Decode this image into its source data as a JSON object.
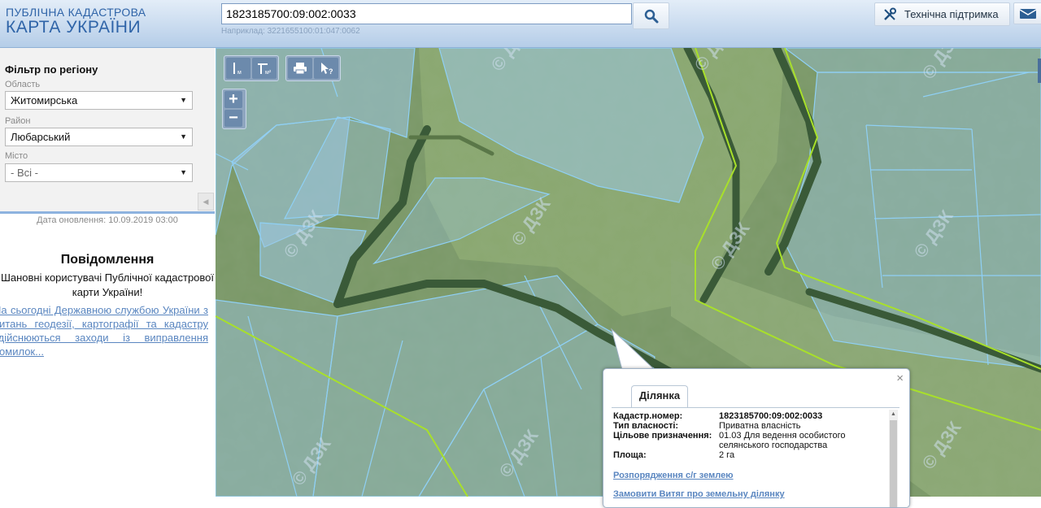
{
  "app": {
    "logo_line1": "ПУБЛІЧНА КАДАСТРОВА",
    "logo_line2": "КАРТА УКРАЇНИ"
  },
  "search": {
    "value": "1823185700:09:002:0033",
    "hint": "Наприклад: 3221655100:01:047:0062"
  },
  "header": {
    "support_label": "Технічна підтримка"
  },
  "filter": {
    "title": "Фільтр по регіону",
    "oblast_label": "Область",
    "oblast_value": "Житомирська",
    "rayon_label": "Район",
    "rayon_value": "Любарський",
    "city_label": "Місто",
    "city_value": "- Всі -"
  },
  "sidebar": {
    "update_date": "Дата оновлення: 10.09.2019 03:00",
    "notice_title": "Повідомлення",
    "notice_greeting": "Шановні користувачі Публічної кадастрової карти України!",
    "notice_link": "На сьогодні Державною службою України з питань геодезії, картографії та кадастру здійснюються заходи із виправлення помилок..."
  },
  "map": {
    "watermark": "© ДЗК",
    "tools": [
      "ruler-icon",
      "area-measure-icon",
      "print-icon",
      "info-cursor-icon"
    ],
    "zoom_in": "+",
    "zoom_out": "−"
  },
  "popup": {
    "tab": "Ділянка",
    "close": "×",
    "cadastral_label": "Кадастр.номер:",
    "cadastral_value": "1823185700:09:002:0033",
    "ownership_label": "Тип власності:",
    "ownership_value": "Приватна власність",
    "purpose_label": "Цільове призначення:",
    "purpose_value": "01.03 Для ведення особистого селянського господарства",
    "area_label": "Площа:",
    "area_value": "2 га",
    "link1": "Розпорядження с/г землею",
    "link2": "Замовити Витяг про земельну ділянку"
  },
  "colors": {
    "header_blue": "#2f64a8",
    "parcel_outline": "#8fd0f5",
    "boundary": "#a8e02a",
    "link": "#5a86c0"
  }
}
